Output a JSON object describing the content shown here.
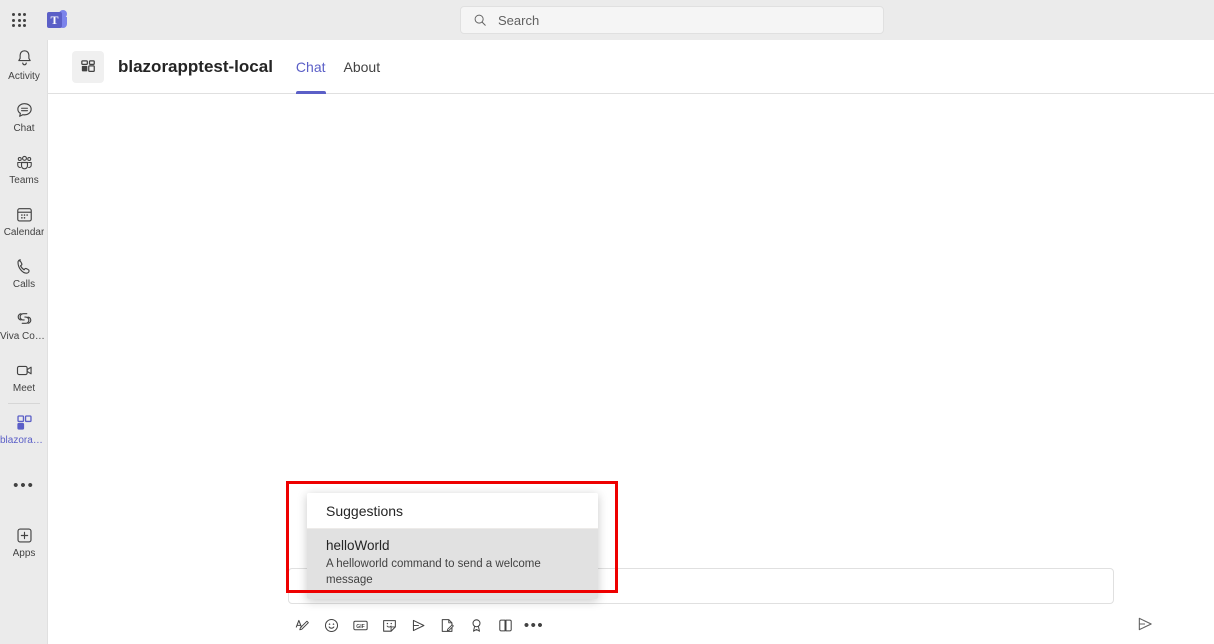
{
  "topbar": {
    "app_launcher_name": "grid-icon",
    "brand": "Microsoft Teams",
    "brand_letter": "T",
    "search": {
      "placeholder": "Search",
      "value": "",
      "icon": "search-icon"
    }
  },
  "rail": {
    "items": [
      {
        "label": "Activity",
        "icon": "bell-icon",
        "active": false
      },
      {
        "label": "Chat",
        "icon": "chat-bubble-icon",
        "active": false
      },
      {
        "label": "Teams",
        "icon": "people-icon",
        "active": false
      },
      {
        "label": "Calendar",
        "icon": "calendar-icon",
        "active": false
      },
      {
        "label": "Calls",
        "icon": "phone-icon",
        "active": false
      },
      {
        "label": "Viva Conne...",
        "icon": "viva-connections-icon",
        "active": false
      },
      {
        "label": "Meet",
        "icon": "video-camera-icon",
        "active": false
      },
      {
        "label": "blazorappt...",
        "icon": "app-blocks-icon",
        "active": true
      }
    ],
    "more_label": "•••",
    "apps": {
      "label": "Apps",
      "icon": "plus-box-icon"
    }
  },
  "app_header": {
    "app_icon": "app-blocks-icon",
    "title": "blazorapptest-local",
    "tabs": [
      {
        "label": "Chat",
        "active": true
      },
      {
        "label": "About",
        "active": false
      }
    ]
  },
  "composer": {
    "message_input": {
      "value": "",
      "placeholder": ""
    },
    "toolbar": [
      {
        "name": "format-icon",
        "label": "Format"
      },
      {
        "name": "emoji-icon",
        "label": "Emoji"
      },
      {
        "name": "gif-icon",
        "label": "GIF"
      },
      {
        "name": "sticker-icon",
        "label": "Sticker"
      },
      {
        "name": "stream-video-icon",
        "label": "Stream"
      },
      {
        "name": "loop-component-icon",
        "label": "Loop component"
      },
      {
        "name": "praise-icon",
        "label": "Praise"
      },
      {
        "name": "approvals-icon",
        "label": "Approvals"
      },
      {
        "name": "more-options-icon",
        "label": "•••"
      }
    ],
    "send": {
      "name": "send-icon",
      "label": "Send"
    }
  },
  "suggestions": {
    "header": "Suggestions",
    "items": [
      {
        "title": "helloWorld",
        "description": "A helloworld command to send a welcome message",
        "selected": true
      }
    ]
  },
  "annotation": {
    "color": "#EE0000",
    "shape": "rectangle"
  },
  "colors": {
    "accent": "#5B5FC7",
    "topbar_bg": "#EBEBEB",
    "rail_bg": "#EBEBEB",
    "content_bg": "#FFFFFF",
    "suggestion_selected_bg": "#E1E1E1",
    "annotation": "#EE0000"
  }
}
